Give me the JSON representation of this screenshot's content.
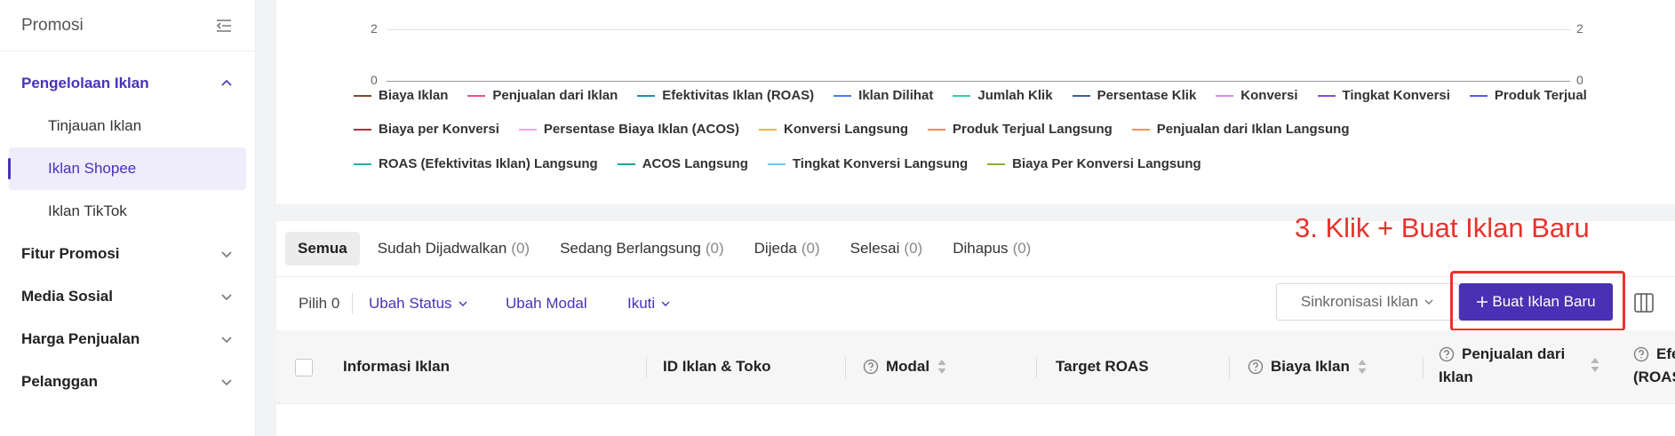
{
  "sidebar": {
    "title": "Promosi",
    "groups": [
      {
        "label": "Pengelolaan Iklan",
        "expanded": true
      },
      {
        "label": "Fitur Promosi"
      },
      {
        "label": "Media Sosial"
      },
      {
        "label": "Harga Penjualan"
      },
      {
        "label": "Pelanggan"
      }
    ],
    "items": [
      {
        "label": "Tinjauan Iklan"
      },
      {
        "label": "Iklan Shopee",
        "selected": true
      },
      {
        "label": "Iklan TikTok"
      }
    ]
  },
  "chart": {
    "left_top_tick": "2",
    "left_bottom_tick": "0",
    "right_top_tick": "2",
    "right_bottom_tick": "0",
    "legend": [
      {
        "label": "Biaya Iklan",
        "color": "#7a4a2a"
      },
      {
        "label": "Penjualan dari Iklan",
        "color": "#f0508a"
      },
      {
        "label": "Efektivitas Iklan (ROAS)",
        "color": "#1c8fb8"
      },
      {
        "label": "Iklan Dilihat",
        "color": "#4a7df0"
      },
      {
        "label": "Jumlah Klik",
        "color": "#3cc9a0"
      },
      {
        "label": "Persentase Klik",
        "color": "#3a5ea8"
      },
      {
        "label": "Konversi",
        "color": "#d98af0"
      },
      {
        "label": "Tingkat Konversi",
        "color": "#8a4ad8"
      },
      {
        "label": "Produk Terjual",
        "color": "#5a5af0"
      },
      {
        "label": "Biaya per Konversi",
        "color": "#a83040"
      },
      {
        "label": "Persentase Biaya Iklan (ACOS)",
        "color": "#f0a8e8"
      },
      {
        "label": "Konversi Langsung",
        "color": "#f0b830"
      },
      {
        "label": "Produk Terjual Langsung",
        "color": "#f08a5a"
      },
      {
        "label": "Penjualan dari Iklan Langsung",
        "color": "#f0905a"
      },
      {
        "label": "ROAS (Efektivitas Iklan) Langsung",
        "color": "#20b0a8"
      },
      {
        "label": "ACOS Langsung",
        "color": "#18a89a"
      },
      {
        "label": "Tingkat Konversi Langsung",
        "color": "#6ac8f0"
      },
      {
        "label": "Biaya Per Konversi Langsung",
        "color": "#88b030"
      }
    ]
  },
  "tabs": [
    {
      "label": "Semua",
      "count": "",
      "active": true
    },
    {
      "label": "Sudah Dijadwalkan",
      "count": "(0)"
    },
    {
      "label": "Sedang Berlangsung",
      "count": "(0)"
    },
    {
      "label": "Dijeda",
      "count": "(0)"
    },
    {
      "label": "Selesai",
      "count": "(0)"
    },
    {
      "label": "Dihapus",
      "count": "(0)"
    }
  ],
  "toolbar": {
    "select_count": "Pilih 0",
    "change_status": "Ubah Status",
    "change_budget": "Ubah Modal",
    "follow": "Ikuti",
    "sync": "Sinkronisasi Iklan",
    "new_ad": "Buat Iklan Baru"
  },
  "annotation": "3. Klik + Buat Iklan Baru",
  "columns": {
    "info": "Informasi Iklan",
    "id": "ID Iklan & Toko",
    "modal": "Modal",
    "target": "Target ROAS",
    "cost": "Biaya Iklan",
    "sales_l1": "Penjualan dari",
    "sales_l2": "Iklan",
    "eff_l1": "Efe",
    "eff_l2": "(ROAS"
  },
  "colors": {
    "accent": "#4930b4",
    "annotation": "#e8332d"
  }
}
